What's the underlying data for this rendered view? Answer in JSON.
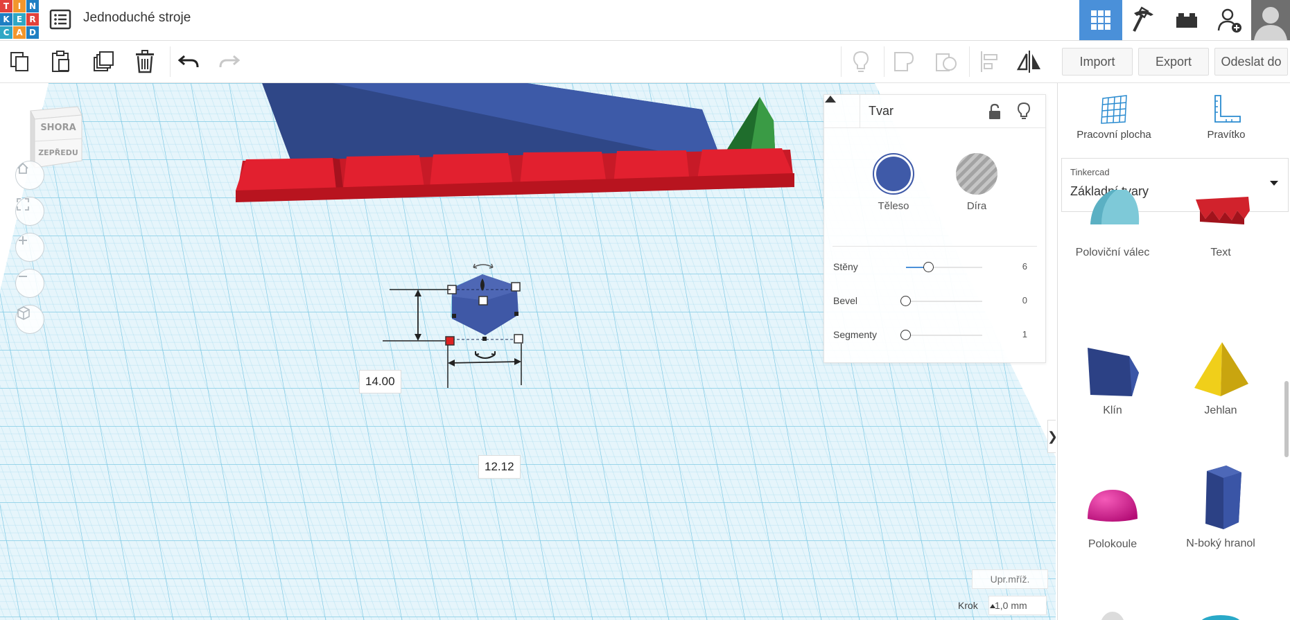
{
  "app": {
    "logo_letters": [
      "T",
      "I",
      "N",
      "K",
      "E",
      "R",
      "C",
      "A",
      "D"
    ],
    "design_title": "Jednoduché stroje"
  },
  "topbar": {
    "icons": [
      "grid-view-icon",
      "pickaxe-icon",
      "bricks-icon",
      "add-user-icon",
      "user-avatar"
    ]
  },
  "toolbar": {
    "icons": [
      "copy-icon",
      "paste-icon",
      "duplicate-icon",
      "delete-icon",
      "undo-icon",
      "redo-icon",
      "show-notes-icon",
      "group-icon",
      "ungroup-icon",
      "align-icon",
      "mirror-icon"
    ],
    "import_label": "Import",
    "export_label": "Export",
    "send_label": "Odeslat do"
  },
  "viewcube": {
    "top_label": "SHORA",
    "front_label": "ZEPŘEDU"
  },
  "workplane": {
    "dimension_height": "14.00",
    "dimension_width": "12.12",
    "grid_button": "Upr.mříž.",
    "step_label": "Krok",
    "step_value": "1,0 mm",
    "colors": {
      "red_block": "#e2202f",
      "blue_wedge": "#3d5aa8",
      "green_wedge": "#2f8a3a",
      "prism": "#3f58a6"
    }
  },
  "inspector": {
    "title": "Tvar",
    "solid_label": "Těleso",
    "hole_label": "Díra",
    "solid_color": "#3f5aa8",
    "properties": [
      {
        "label": "Stěny",
        "value": "6",
        "fraction": 0.3
      },
      {
        "label": "Bevel",
        "value": "0",
        "fraction": 0.0
      },
      {
        "label": "Segmenty",
        "value": "1",
        "fraction": 0.0
      }
    ]
  },
  "right_panel": {
    "workplane_button": "Pracovní plocha",
    "ruler_button": "Pravítko",
    "library_source": "Tinkercad",
    "library_name": "Základní tvary",
    "shapes": [
      {
        "label": "Poloviční válec",
        "icon": "half-cylinder-icon"
      },
      {
        "label": "Text",
        "icon": "text-shape-icon"
      },
      {
        "label": "Klín",
        "icon": "wedge-icon"
      },
      {
        "label": "Jehlan",
        "icon": "pyramid-icon"
      },
      {
        "label": "Polokoule",
        "icon": "half-sphere-icon"
      },
      {
        "label": "N-boký hranol",
        "icon": "polygon-prism-icon"
      }
    ]
  }
}
